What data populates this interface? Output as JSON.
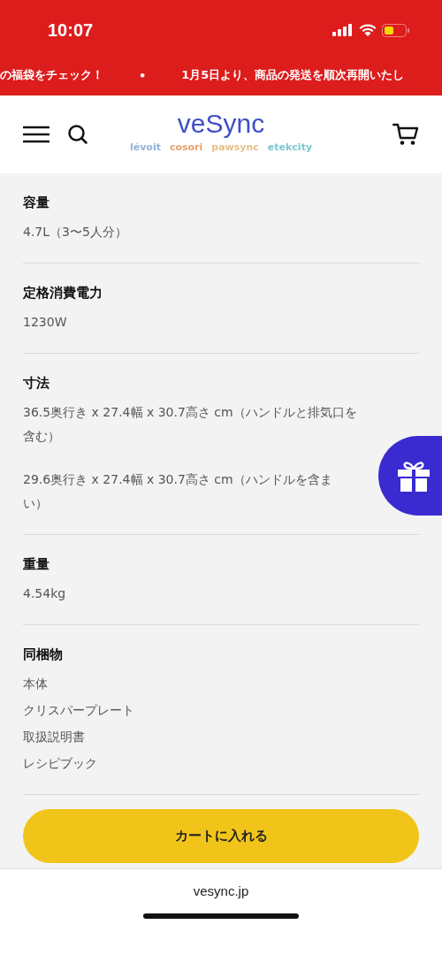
{
  "status_bar": {
    "time": "10:07"
  },
  "ticker": [
    "の福袋をチェック！",
    "•",
    "1月5日より、商品の発送を順次再開いたし"
  ],
  "header": {
    "logo": "veSync",
    "brands": [
      {
        "label": "lévoit",
        "color": "#8fb3d9"
      },
      {
        "label": "cosori",
        "color": "#e8a070"
      },
      {
        "label": "pawsync",
        "color": "#e6c08a"
      },
      {
        "label": "etekcity",
        "color": "#7cc6d0"
      }
    ]
  },
  "specs": [
    {
      "label": "容量",
      "values": [
        [
          "4.7L（3〜5人分）"
        ]
      ]
    },
    {
      "label": "定格消費電力",
      "values": [
        [
          "1230W"
        ]
      ]
    },
    {
      "label": "寸法",
      "values": [
        [
          "36.5奥行き x 27.4幅 x 30.7高さ cm（ハンドルと排気口を",
          "含む）"
        ],
        [
          "29.6奥行き x 27.4幅 x 30.7高さ cm（ハンドルを含ま",
          "い）"
        ]
      ]
    },
    {
      "label": "重量",
      "values": [
        [
          "4.54kg"
        ]
      ]
    },
    {
      "label": "同梱物",
      "values": [
        [
          "本体"
        ],
        [
          "クリスパープレート"
        ],
        [
          "取扱説明書"
        ],
        [
          "レシピブック"
        ]
      ]
    }
  ],
  "cart_button": "カートに入れる",
  "browser": {
    "url": "vesync.jp"
  }
}
